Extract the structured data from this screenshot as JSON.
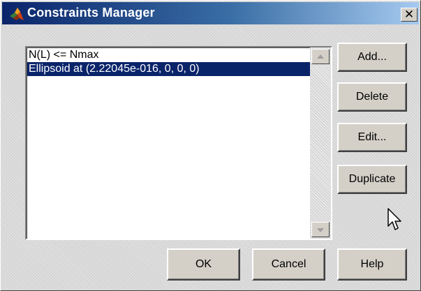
{
  "window": {
    "title": "Constraints Manager",
    "app_icon": "matlab-logo-icon",
    "close_glyph": "✕"
  },
  "constraints_list": {
    "items": [
      {
        "label": "N(L) <= Nmax",
        "selected": false
      },
      {
        "label": "Ellipsoid at (2.22045e-016, 0, 0, 0)",
        "selected": true
      }
    ]
  },
  "buttons": {
    "add": "Add...",
    "delete": "Delete",
    "edit": "Edit...",
    "duplicate": "Duplicate",
    "ok": "OK",
    "cancel": "Cancel",
    "help": "Help"
  },
  "colors": {
    "titlebar_start": "#0a246a",
    "titlebar_end": "#a6caf0",
    "selection_bg": "#0a246a",
    "selection_text": "#ffffff",
    "button_face": "#d4d0c8"
  }
}
